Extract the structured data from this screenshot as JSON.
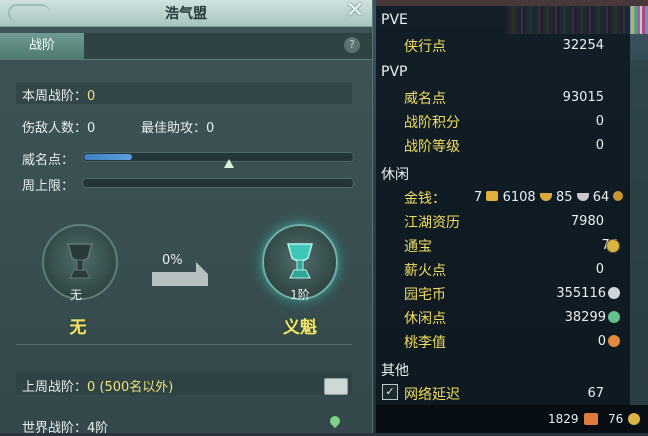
{
  "window": {
    "title": "浩气盟"
  },
  "tabs": [
    {
      "label": "战阶"
    }
  ],
  "left": {
    "weekly_rank_label": "本周战阶：",
    "weekly_rank_value": "0",
    "kills_label": "伤敌人数：",
    "kills_value": "0",
    "assist_label": "最佳助攻：",
    "assist_value": "0",
    "prestige_label": "威名点：",
    "prestige_progress": 0.18,
    "weekly_cap_label": "周上限：",
    "weekly_cap_progress": 0,
    "progress_percent": "0%",
    "current_rank_caption": "无",
    "current_rank_name": "无",
    "next_rank_caption": "1阶",
    "next_rank_name": "义魁",
    "last_week_label": "上周战阶：",
    "last_week_value": "0 (500名以外)",
    "world_rank_label": "世界战阶：",
    "world_rank_value": "4阶"
  },
  "stats": {
    "pve": {
      "header": "PVE",
      "items": [
        {
          "label": "侠行点",
          "value": "32254"
        }
      ]
    },
    "pvp": {
      "header": "PVP",
      "items": [
        {
          "label": "威名点",
          "value": "93015"
        },
        {
          "label": "战阶积分",
          "value": "0"
        },
        {
          "label": "战阶等级",
          "value": "0"
        }
      ]
    },
    "leisure": {
      "header": "休闲",
      "money_label": "金钱：",
      "money_bricks": "7",
      "money_gold": "6108",
      "money_silver": "85",
      "money_copper": "64",
      "items": [
        {
          "label": "江湖资历",
          "value": "7980"
        },
        {
          "label": "通宝",
          "value": "76"
        },
        {
          "label": "薪火点",
          "value": "0"
        },
        {
          "label": "园宅币",
          "value": "355116"
        },
        {
          "label": "休闲点",
          "value": "38299"
        },
        {
          "label": "桃李值",
          "value": "0"
        }
      ]
    },
    "other": {
      "header": "其他",
      "items": [
        {
          "label": "网络延迟",
          "value": "67",
          "checked": true
        }
      ]
    },
    "bottom": {
      "left_value": "1829",
      "right_value": "76"
    }
  },
  "colors": {
    "accent_yellow": "#f0dc60",
    "progress_blue": "#4a90d8",
    "panel_bg": "#3a4f52"
  }
}
